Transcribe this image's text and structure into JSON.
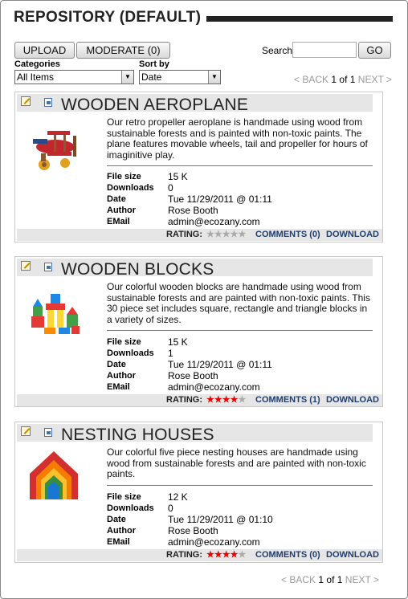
{
  "header": {
    "title": "REPOSITORY (DEFAULT)"
  },
  "toolbar": {
    "upload_label": "UPLOAD",
    "moderate_label": "MODERATE (0)",
    "search_label": "Search",
    "search_value": "",
    "go_label": "GO"
  },
  "filters": {
    "categories_label": "Categories",
    "categories_value": "All Items",
    "sortby_label": "Sort by",
    "sortby_value": "Date"
  },
  "pager": {
    "back": "< BACK",
    "current": "1",
    "of": "of",
    "total": "1",
    "next": "NEXT >"
  },
  "meta_labels": {
    "file_size": "File size",
    "downloads": "Downloads",
    "date": "Date",
    "author": "Author",
    "email": "EMail"
  },
  "footer_labels": {
    "rating": "RATING:",
    "download": "DOWNLOAD"
  },
  "items": [
    {
      "title": "WOODEN AEROPLANE",
      "description": "Our retro propeller aeroplane is handmade using wood from sustainable forests and is painted with non-toxic paints. The plane features movable wheels, tail and propeller for hours of imaginitive play.",
      "file_size": "15 K",
      "downloads": "0",
      "date": "Tue 11/29/2011 @ 01:11",
      "author": "Rose Booth",
      "email": "admin@ecozany.com",
      "rating": 0,
      "comments": "COMMENTS (0)"
    },
    {
      "title": "WOODEN BLOCKS",
      "description": "Our colorful wooden blocks are handmade using wood from sustainable forests and are painted with non-toxic paints. This 30 piece set includes square, rectangle and triangle blocks in a variety of sizes.",
      "file_size": "15 K",
      "downloads": "1",
      "date": "Tue 11/29/2011 @ 01:11",
      "author": "Rose Booth",
      "email": "admin@ecozany.com",
      "rating": 4,
      "comments": "COMMENTS (1)"
    },
    {
      "title": "NESTING HOUSES",
      "description": "Our colorful five piece nesting houses are handmade using wood from sustainable forests and are painted with non-toxic paints.",
      "file_size": "12 K",
      "downloads": "0",
      "date": "Tue 11/29/2011 @ 01:10",
      "author": "Rose Booth",
      "email": "admin@ecozany.com",
      "rating": 4,
      "comments": "COMMENTS (0)"
    }
  ],
  "colors": {
    "star_on": "#e00000",
    "star_off": "#aaaaaa",
    "link": "#1f3d6e"
  }
}
